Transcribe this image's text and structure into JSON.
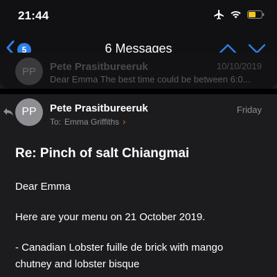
{
  "status": {
    "time": "21:44"
  },
  "nav": {
    "back_count": "5",
    "title": "6 Messages"
  },
  "previous": {
    "avatar": "PP",
    "sender": "Pete Prasitbureeruk",
    "date": "10/10/2019",
    "snippet": "Dear Emma The best time could be between 6:0..."
  },
  "message": {
    "avatar": "PP",
    "sender": "Pete Prasitbureeruk",
    "date": "Friday",
    "to_label": "To:",
    "to_name": "Emma Griffiths",
    "subject": "Re:  Pinch of salt Chiangmai",
    "body": [
      "Dear Emma",
      "Here are your menu on 21 October 2019.",
      "- Canadian Lobster fuille de brick with mango",
      "chutney and lobster bisque"
    ]
  },
  "colors": {
    "accent": "#2f7fe6",
    "battery": "#f5c518",
    "chevron": "#e0653c"
  }
}
